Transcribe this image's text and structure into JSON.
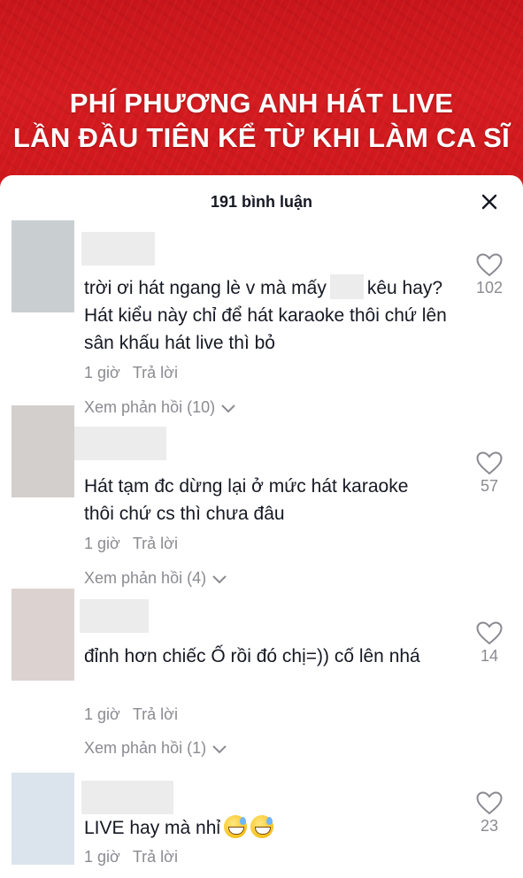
{
  "banner": {
    "line1": "PHÍ PHƯƠNG ANH HÁT LIVE",
    "line2": "LẦN ĐẦU TIÊN KỂ TỪ KHI LÀM CA SĨ"
  },
  "sheet": {
    "title": "191 bình luận",
    "close_icon": "close-icon"
  },
  "comments": [
    {
      "avatar_color": "#c9ced1",
      "text_before": "trời ơi hát ngang lè v mà mấy",
      "text_after": "kêu",
      "text_rest": "hay? Hát kiểu này chỉ để hát karaoke thôi chứ lên sân khấu hát live thì bỏ",
      "time": "1 giờ",
      "reply_label": "Trả lời",
      "view_replies": "Xem phản hồi (10)",
      "likes": "102"
    },
    {
      "avatar_color": "#d3cfcc",
      "text": "Hát tạm đc dừng lại ở mức hát karaoke thôi chứ cs thì chưa đâu",
      "time": "1 giờ",
      "reply_label": "Trả lời",
      "view_replies": "Xem phản hồi (4)",
      "likes": "57"
    },
    {
      "avatar_color": "#dcd3d1",
      "text": "đỉnh hơn chiếc Ố rồi đó chị=)) cố lên nhá",
      "time": "1 giờ",
      "reply_label": "Trả lời",
      "view_replies": "Xem phản hồi (1)",
      "likes": "14"
    },
    {
      "avatar_color": "#dbe4ec",
      "text": "LIVE hay mà nhỉ",
      "time": "1 giờ",
      "reply_label": "Trả lời",
      "likes": "23"
    }
  ],
  "icons": {
    "like": "heart-outline-icon",
    "expand": "chevron-down-icon",
    "emoji": "grinning-sweat-emoji"
  },
  "colors": {
    "banner_red": "#d41b1f",
    "text_primary": "#161823",
    "text_secondary": "#8a8b91"
  }
}
